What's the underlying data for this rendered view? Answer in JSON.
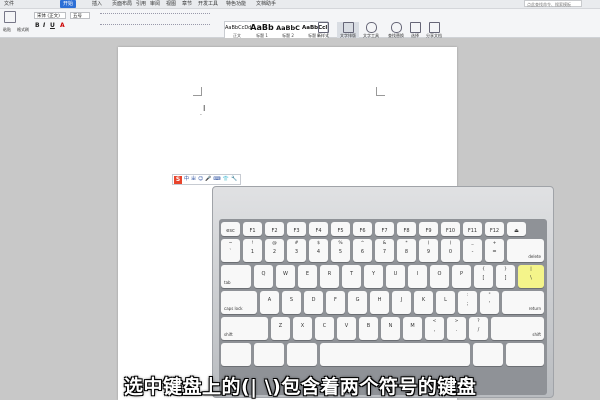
{
  "menubar": {
    "items": [
      "文件",
      "开始",
      "插入",
      "页面布局",
      "引用",
      "审阅",
      "视图",
      "章节",
      "开发工具",
      "特色功能",
      "文档助手"
    ],
    "help_placeholder": "点此查找命令、搜索模板"
  },
  "ribbon": {
    "font_name": "宋体 (正文)",
    "font_size": "五号",
    "paste_label": "粘贴",
    "format_painter_label": "格式刷",
    "format_buttons": [
      "B",
      "I",
      "U",
      "A"
    ],
    "styles": [
      {
        "sample": "AaBbCcDd",
        "name": "正文"
      },
      {
        "sample": "AaBb",
        "name": "标题 1"
      },
      {
        "sample": "AaBbC",
        "name": "标题 2"
      },
      {
        "sample": "AaBbCcl",
        "name": "标题 3"
      }
    ],
    "buttons": [
      "新样式",
      "文字排版",
      "文字工具",
      "查找替换",
      "选择",
      "分享文档"
    ]
  },
  "ime": {
    "logo": "S",
    "items": [
      "中",
      "ㄓ",
      "☺",
      "🎤",
      "⌨",
      "👕",
      "🔧"
    ]
  },
  "keyboard": {
    "fn_row": [
      "esc",
      "F1",
      "F2",
      "F3",
      "F4",
      "F5",
      "F6",
      "F7",
      "F8",
      "F9",
      "F10",
      "F11",
      "F12",
      "⏏"
    ],
    "number_row": [
      {
        "top": "~",
        "bottom": "`"
      },
      {
        "top": "!",
        "bottom": "1"
      },
      {
        "top": "@",
        "bottom": "2"
      },
      {
        "top": "#",
        "bottom": "3"
      },
      {
        "top": "$",
        "bottom": "4"
      },
      {
        "top": "%",
        "bottom": "5"
      },
      {
        "top": "^",
        "bottom": "6"
      },
      {
        "top": "&",
        "bottom": "7"
      },
      {
        "top": "*",
        "bottom": "8"
      },
      {
        "top": "(",
        "bottom": "9"
      },
      {
        "top": ")",
        "bottom": "0"
      },
      {
        "top": "_",
        "bottom": "-"
      },
      {
        "top": "+",
        "bottom": "="
      }
    ],
    "delete_label": "delete",
    "tab_label": "tab",
    "qwerty_row": [
      "Q",
      "W",
      "E",
      "R",
      "T",
      "Y",
      "U",
      "I",
      "O",
      "P"
    ],
    "bracket_keys": [
      {
        "top": "{",
        "bottom": "["
      },
      {
        "top": "}",
        "bottom": "]"
      }
    ],
    "highlighted_key": {
      "top": "|",
      "bottom": "\\"
    },
    "caps_label": "caps lock",
    "asdf_row": [
      "A",
      "S",
      "D",
      "F",
      "G",
      "H",
      "J",
      "K",
      "L"
    ],
    "asdf_extra": [
      {
        "top": ":",
        "bottom": ";"
      },
      {
        "top": "\"",
        "bottom": "'"
      }
    ],
    "return_label": "return",
    "shift_label": "shift",
    "zxcv_row": [
      "Z",
      "X",
      "C",
      "V",
      "B",
      "N",
      "M"
    ],
    "zxcv_extra": [
      {
        "top": "<",
        "bottom": ","
      },
      {
        "top": ">",
        "bottom": "."
      },
      {
        "top": "?",
        "bottom": "/"
      }
    ]
  },
  "subtitle": "选中键盘上的(|  \\)包含着两个符号的键盘",
  "colors": {
    "accent": "#2d6fd6",
    "highlight_key": "#f4f48a"
  }
}
